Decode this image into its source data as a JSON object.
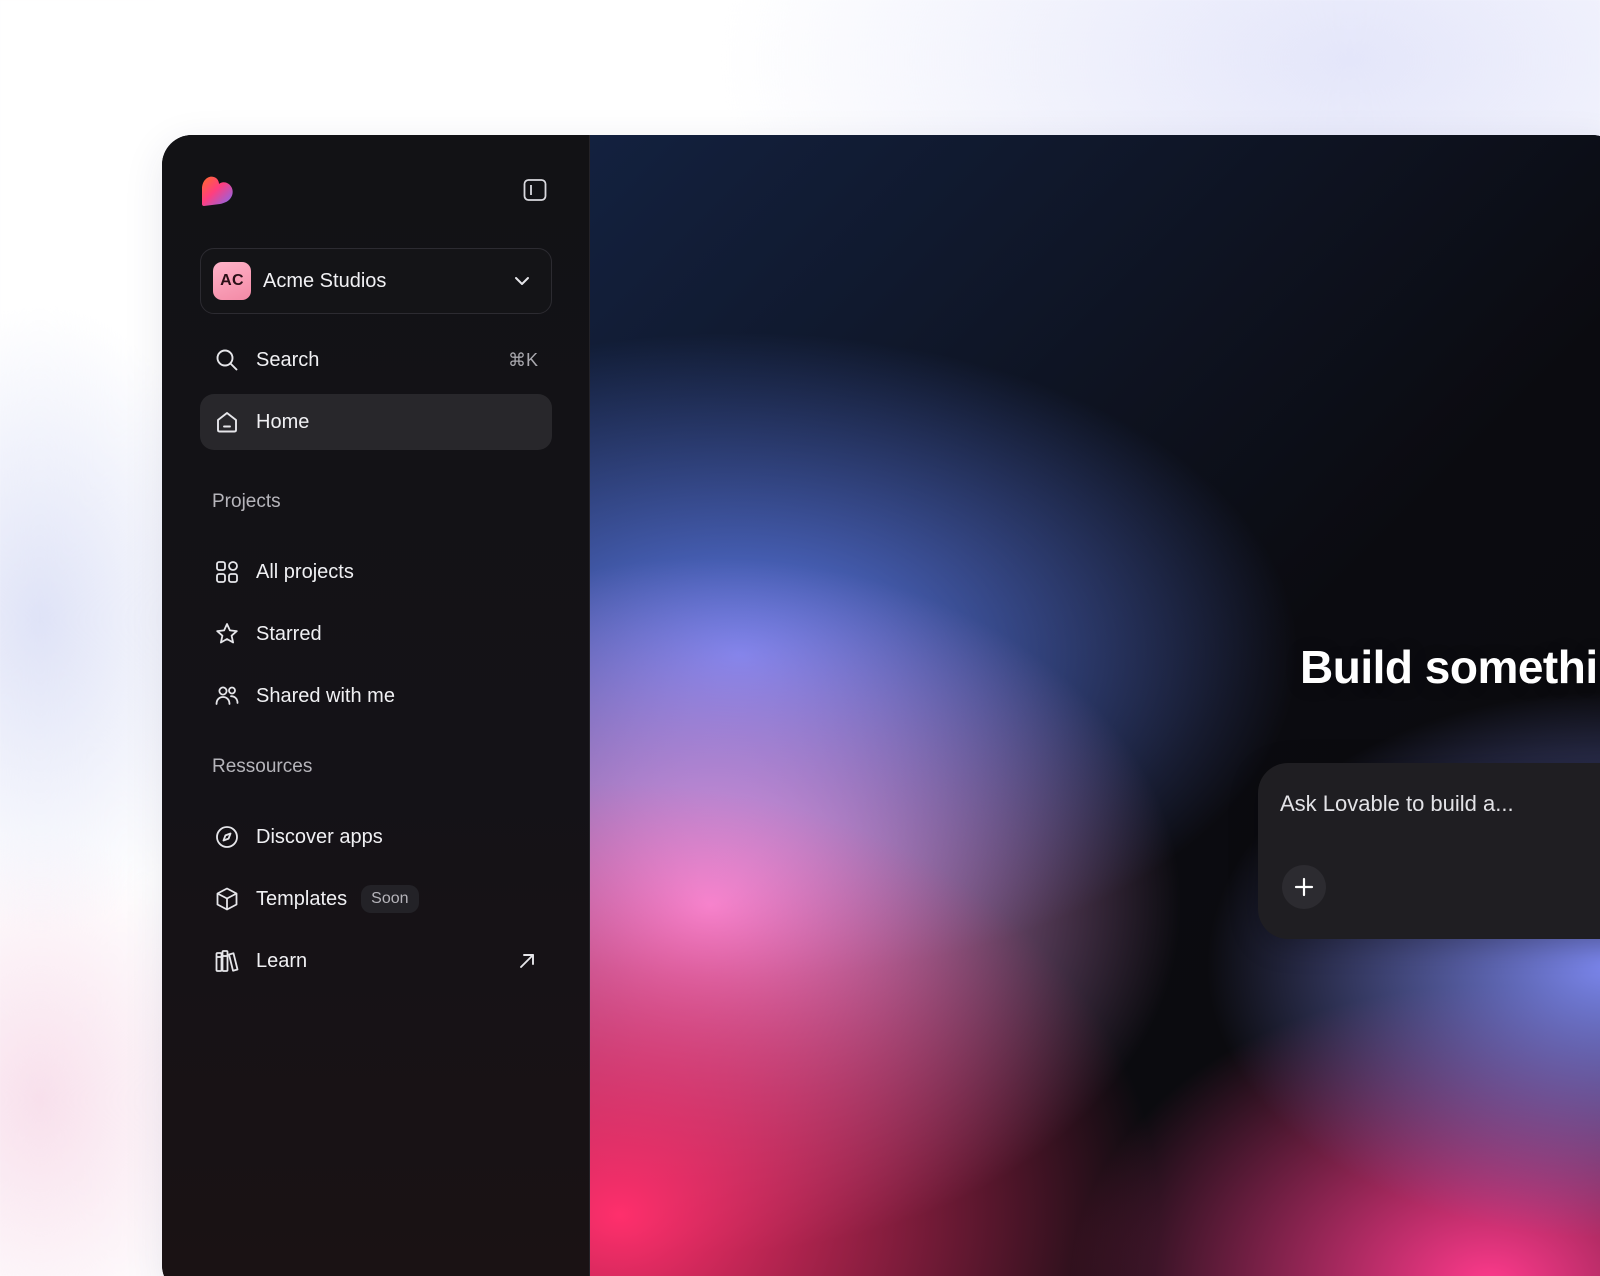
{
  "workspace": {
    "initials": "AC",
    "name": "Acme Studios"
  },
  "nav": {
    "search_label": "Search",
    "search_shortcut": "⌘K",
    "home_label": "Home"
  },
  "projects": {
    "title": "Projects",
    "items": [
      {
        "label": "All projects",
        "icon": "grid-icon"
      },
      {
        "label": "Starred",
        "icon": "star-icon"
      },
      {
        "label": "Shared with me",
        "icon": "users-icon"
      }
    ]
  },
  "resources": {
    "title": "Ressources",
    "items": [
      {
        "label": "Discover apps",
        "icon": "compass-icon"
      },
      {
        "label": "Templates",
        "icon": "cube-icon",
        "badge": "Soon"
      },
      {
        "label": "Learn",
        "icon": "books-icon",
        "external": "arrow-up-right-icon"
      }
    ]
  },
  "main": {
    "headline": "Build somethi",
    "prompt_placeholder": "Ask Lovable to build a..."
  },
  "colors": {
    "sidebar_bg": "#121215",
    "active_item_bg": "#28272b",
    "accent_pink": "#ff2f6c",
    "accent_blue": "#5b7ae9"
  }
}
